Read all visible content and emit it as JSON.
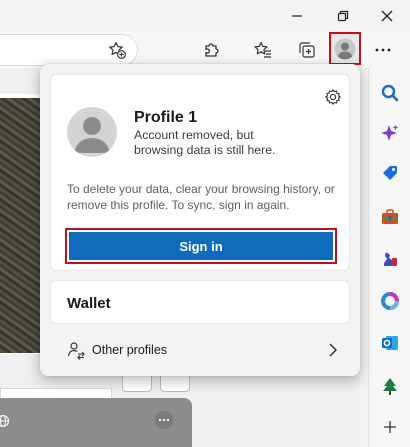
{
  "window": {
    "minimize_icon": "minimize-icon",
    "restore_icon": "restore-icon",
    "close_icon": "close-icon"
  },
  "toolbar": {
    "add_favorite_icon": "star-plus-icon",
    "extensions_icon": "puzzle-icon",
    "favorites_icon": "star-list-icon",
    "collections_icon": "collections-icon",
    "profile_icon": "person-icon",
    "more_icon": "ellipsis-icon"
  },
  "profile_flyout": {
    "name": "Profile 1",
    "status": "Account removed, but browsing data is still here.",
    "note": "To delete your data, clear your browsing history, or remove this profile. To sync, sign in again.",
    "sign_in_label": "Sign in",
    "wallet_label": "Wallet",
    "other_profiles_label": "Other profiles"
  },
  "sidebar": {
    "items": [
      "search-icon",
      "copilot-icon",
      "shopping-tag-icon",
      "tools-icon",
      "games-icon",
      "microsoft-365-icon",
      "outlook-icon",
      "tree-icon",
      "add-icon"
    ]
  },
  "colors": {
    "accent": "#0f6cbd",
    "highlight_outline": "#c4101c",
    "background": "#f3f3f3"
  }
}
